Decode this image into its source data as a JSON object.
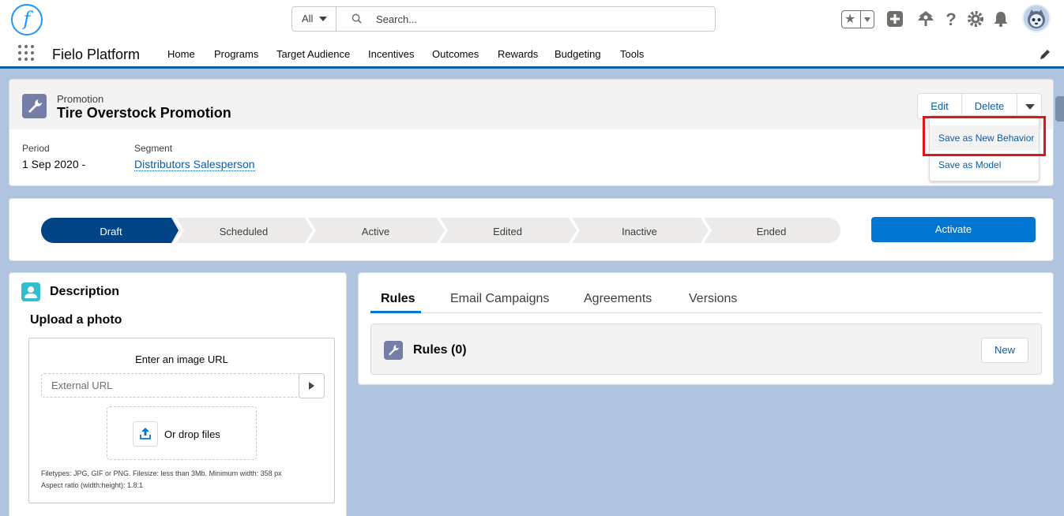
{
  "header": {
    "logo_letter": "f",
    "search_scope": "All",
    "search_placeholder": "Search..."
  },
  "nav": {
    "app_name": "Fielo Platform",
    "items": [
      "Home",
      "Programs",
      "Target Audience",
      "Incentives",
      "Outcomes",
      "Rewards",
      "Budgeting",
      "Tools"
    ]
  },
  "record": {
    "object_type": "Promotion",
    "title": "Tire Overstock Promotion",
    "actions": {
      "edit": "Edit",
      "delete": "Delete"
    },
    "fields": {
      "period_label": "Period",
      "period_value": "1 Sep 2020 -",
      "segment_label": "Segment",
      "segment_value": "Distributors Salesperson"
    },
    "dropdown": [
      "Save as New Behavior",
      "Save as Model"
    ]
  },
  "path": {
    "stages": [
      "Draft",
      "Scheduled",
      "Active",
      "Edited",
      "Inactive",
      "Ended"
    ],
    "current": "Draft",
    "action": "Activate"
  },
  "description": {
    "title": "Description",
    "upload_title": "Upload a photo",
    "url_label": "Enter an image URL",
    "url_placeholder": "External URL",
    "drop_label": "Or drop files",
    "help_line1": "Filetypes: JPG, GIF or PNG. Filesize: less than 3Mb. Minimum width: 358 px",
    "help_line2": "Aspect ratio (width:height): 1.8:1"
  },
  "tabs": {
    "items": [
      "Rules",
      "Email Campaigns",
      "Agreements",
      "Versions"
    ],
    "active": "Rules",
    "rules_title": "Rules (0)",
    "new_label": "New"
  },
  "colors": {
    "brand": "#0176d3",
    "path_current": "#014486",
    "path_incomplete": "#ecebea",
    "highlight_box": "#e3151c",
    "page_bg": "#b0c4df"
  },
  "icons": {
    "search": "search-icon",
    "favorites": "star-icon",
    "add": "plus-icon",
    "trailhead": "trailhead-icon",
    "help": "help-icon",
    "setup": "gear-icon",
    "notifications": "bell-icon",
    "app_launcher": "waffle-icon",
    "edit_nav": "pencil-icon",
    "record": "wrench-icon",
    "description": "contact-icon",
    "upload": "upload-icon"
  }
}
